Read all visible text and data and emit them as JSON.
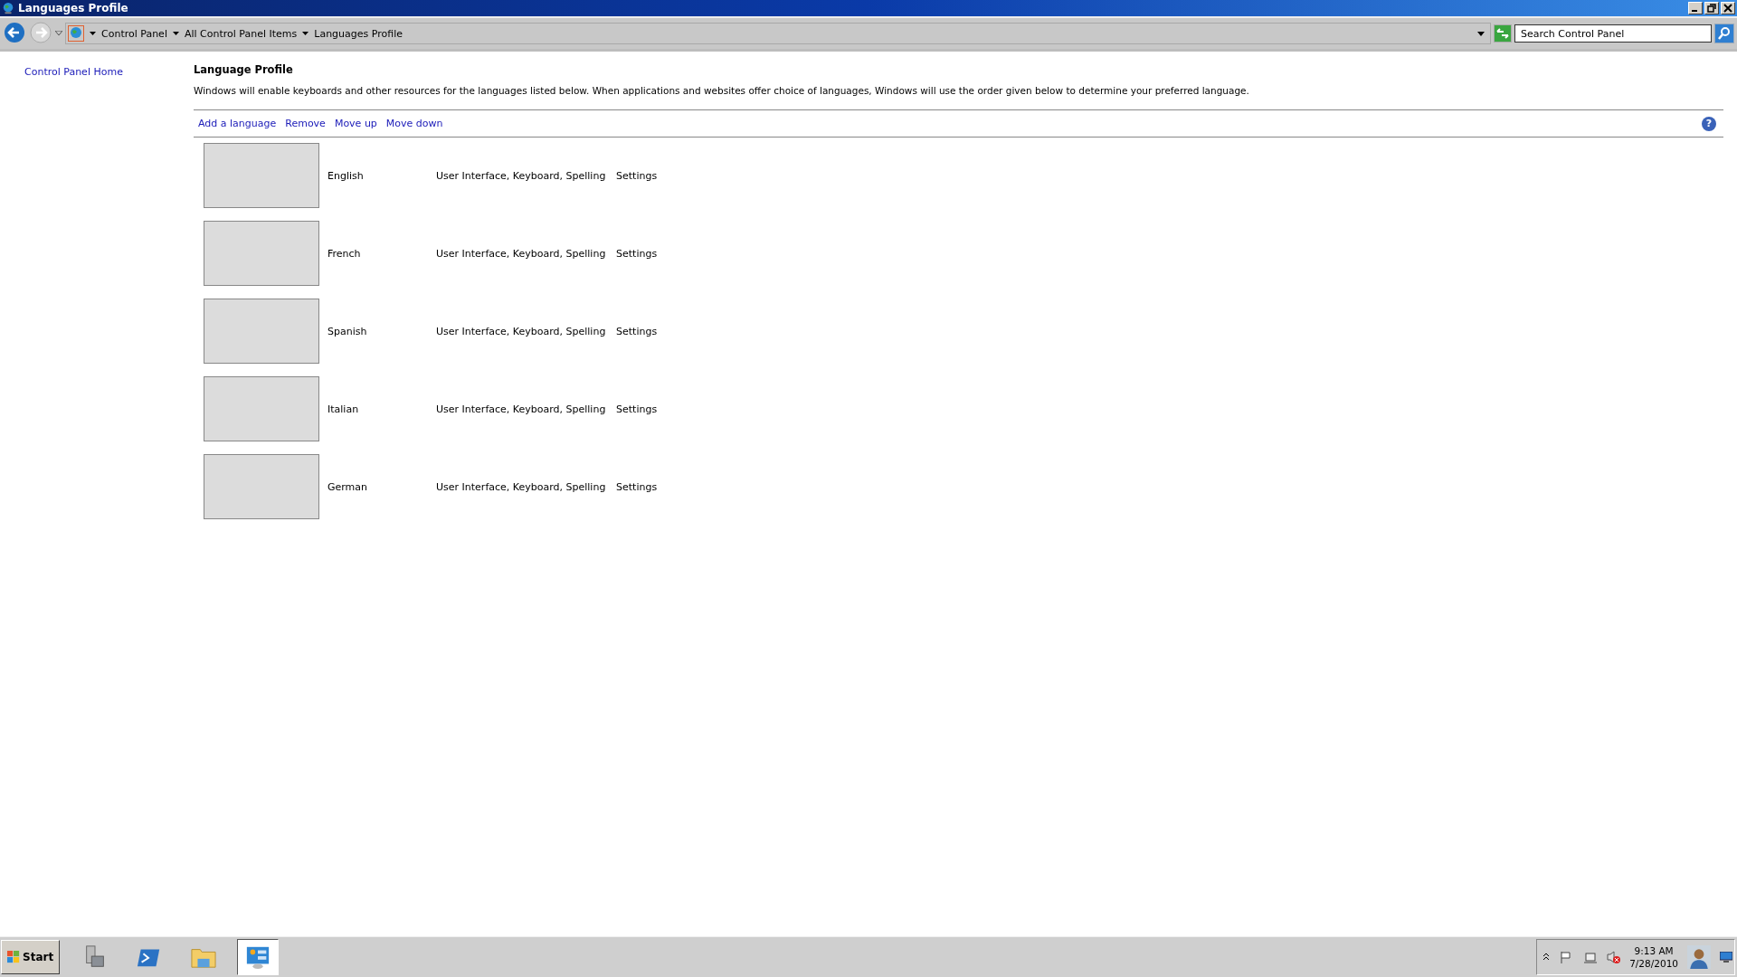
{
  "window": {
    "title": "Languages Profile"
  },
  "address_bar": {
    "breadcrumbs": [
      "Control Panel",
      "All Control Panel Items",
      "Languages Profile"
    ]
  },
  "search": {
    "placeholder": "Search Control Panel"
  },
  "sidebar": {
    "items": [
      "Control Panel Home"
    ]
  },
  "page": {
    "heading": "Language Profile",
    "description": "Windows will enable keyboards and other resources for the languages listed below. When applications and websites offer choice of languages, Windows will use the order given below to determine your preferred language."
  },
  "toolbar": {
    "actions": [
      "Add a language",
      "Remove",
      "Move up",
      "Move down"
    ],
    "help": "?"
  },
  "languages": [
    {
      "name": "English",
      "features": "User Interface, Keyboard, Spelling",
      "action": "Settings"
    },
    {
      "name": "French",
      "features": "User Interface, Keyboard, Spelling",
      "action": "Settings"
    },
    {
      "name": "Spanish",
      "features": "User Interface, Keyboard, Spelling",
      "action": "Settings"
    },
    {
      "name": "Italian",
      "features": "User Interface, Keyboard, Spelling",
      "action": "Settings"
    },
    {
      "name": "German",
      "features": "User Interface, Keyboard, Spelling",
      "action": "Settings"
    }
  ],
  "taskbar": {
    "start": "Start",
    "items": [
      {
        "kind": "server",
        "selected": false
      },
      {
        "kind": "shell",
        "selected": false
      },
      {
        "kind": "folder",
        "selected": false
      },
      {
        "kind": "control-panel",
        "selected": true
      }
    ],
    "clock": {
      "time": "9:13 AM",
      "date": "7/28/2010"
    }
  }
}
